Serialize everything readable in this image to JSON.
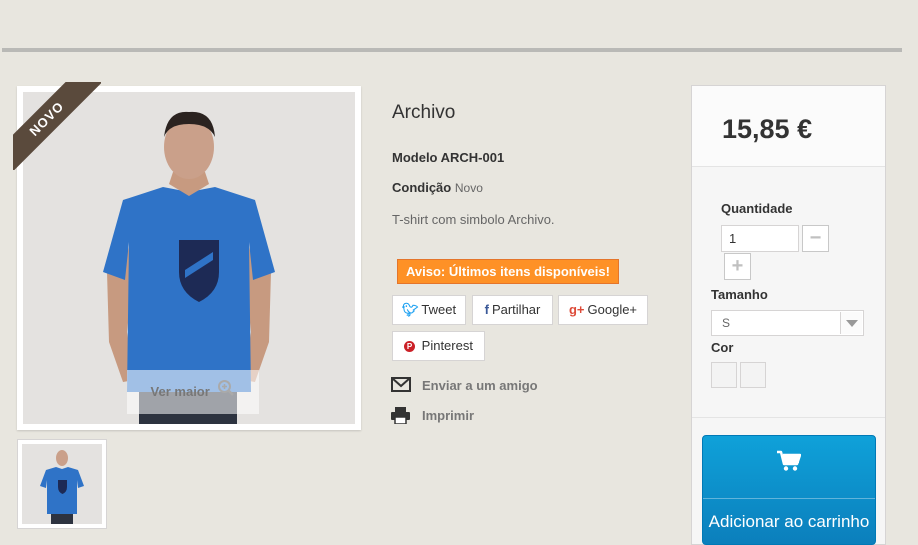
{
  "product": {
    "title": "Archivo",
    "ribbon": "NOVO",
    "zoom_label": "Ver maior",
    "model_label": "Modelo ARCH-001",
    "condition_label": "Condição",
    "condition_value": "Novo",
    "description": "T-shirt com simbolo Archivo.",
    "warning": "Aviso: Últimos itens disponíveis!"
  },
  "social": {
    "tweet": "Tweet",
    "share": "Partilhar",
    "gplus": "Google+",
    "pinterest": "Pinterest"
  },
  "actions": {
    "send_friend": "Enviar a um amigo",
    "print": "Imprimir"
  },
  "buy_box": {
    "price": "15,85 €",
    "quantity_label": "Quantidade",
    "quantity_value": "1",
    "size_label": "Tamanho",
    "size_selected": "S",
    "color_label": "Cor",
    "add_to_cart": "Adicionar ao carrinho"
  },
  "colors": {
    "accent_blue": "#0b7fbc",
    "warning_orange": "#fe9126",
    "ribbon_brown": "#5a4a3c"
  },
  "icons": [
    "zoom-icon",
    "twitter-icon",
    "facebook-icon",
    "google-plus-icon",
    "pinterest-icon",
    "envelope-icon",
    "print-icon",
    "cart-icon",
    "minus-icon",
    "plus-icon",
    "chevron-down-icon"
  ]
}
